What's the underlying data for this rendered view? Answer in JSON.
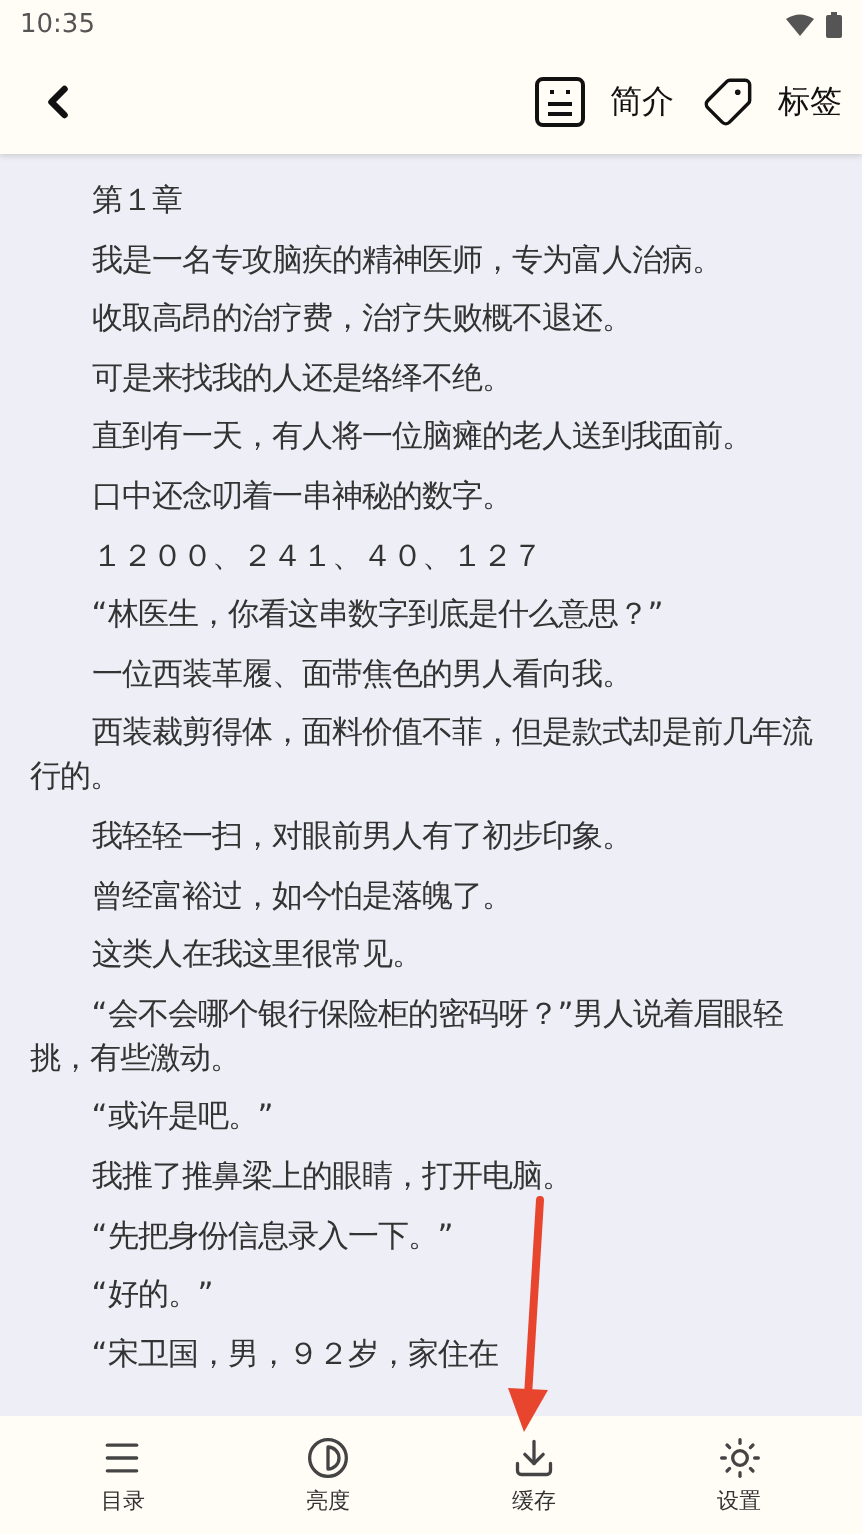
{
  "status_bar": {
    "time": "10:35"
  },
  "header": {
    "actions": [
      {
        "kind": "intro",
        "label": "简介"
      },
      {
        "kind": "tag",
        "label": "标签"
      }
    ]
  },
  "content": {
    "paragraphs": [
      "第１章",
      "我是一名专攻脑疾的精神医师，专为富人治病。",
      "收取高昂的治疗费，治疗失败概不退还。",
      "可是来找我的人还是络绎不绝。",
      "直到有一天，有人将一位脑瘫的老人送到我面前。",
      "口中还念叨着一串神秘的数字。",
      "１２００、２４１、４０、１２７",
      "“林医生，你看这串数字到底是什么意思？”",
      "一位西装革履、面带焦色的男人看向我。",
      "西装裁剪得体，面料价值不菲，但是款式却是前几年流行的。",
      "我轻轻一扫，对眼前男人有了初步印象。",
      "曾经富裕过，如今怕是落魄了。",
      "这类人在我这里很常见。",
      "“会不会哪个银行保险柜的密码呀？”男人说着眉眼轻挑，有些激动。",
      "“或许是吧。”",
      "我推了推鼻梁上的眼睛，打开电脑。",
      "“先把身份信息录入一下。”",
      "“好的。”",
      "“宋卫国，男，９２岁，家住在"
    ]
  },
  "bottom_nav": [
    {
      "kind": "toc",
      "label": "目录"
    },
    {
      "kind": "brightness",
      "label": "亮度"
    },
    {
      "kind": "cache",
      "label": "缓存"
    },
    {
      "kind": "settings",
      "label": "设置"
    }
  ]
}
